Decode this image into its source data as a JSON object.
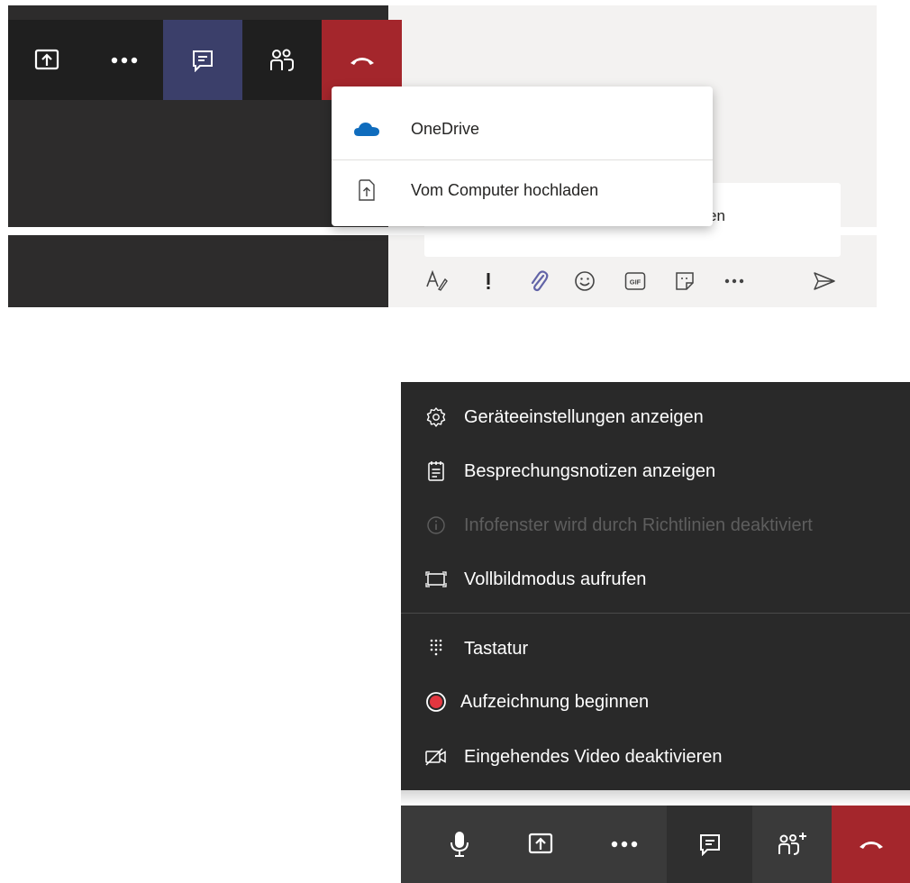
{
  "upload_menu": {
    "items": [
      {
        "label": "OneDrive",
        "icon": "onedrive-cloud-icon"
      },
      {
        "label": "Vom Computer hochladen",
        "icon": "upload-file-icon"
      }
    ]
  },
  "compose": {
    "partial_text": "en"
  },
  "more_menu": {
    "items": [
      {
        "label": "Geräteeinstellungen anzeigen",
        "icon": "gear-icon"
      },
      {
        "label": "Besprechungsnotizen anzeigen",
        "icon": "notes-icon"
      },
      {
        "label": "Infofenster wird durch Richtlinien deaktiviert",
        "icon": "info-icon",
        "disabled": true
      },
      {
        "label": "Vollbildmodus aufrufen",
        "icon": "fullscreen-icon"
      },
      {
        "label": "Tastatur",
        "icon": "keypad-icon"
      },
      {
        "label": "Aufzeichnung beginnen",
        "icon": "record-icon"
      },
      {
        "label": "Eingehendes Video deaktivieren",
        "icon": "video-off-icon"
      }
    ]
  },
  "colors": {
    "leave": "#a4262c",
    "record": "#e2363f",
    "onedrive": "#0f6cbd",
    "attach_accent": "#6264a7"
  }
}
